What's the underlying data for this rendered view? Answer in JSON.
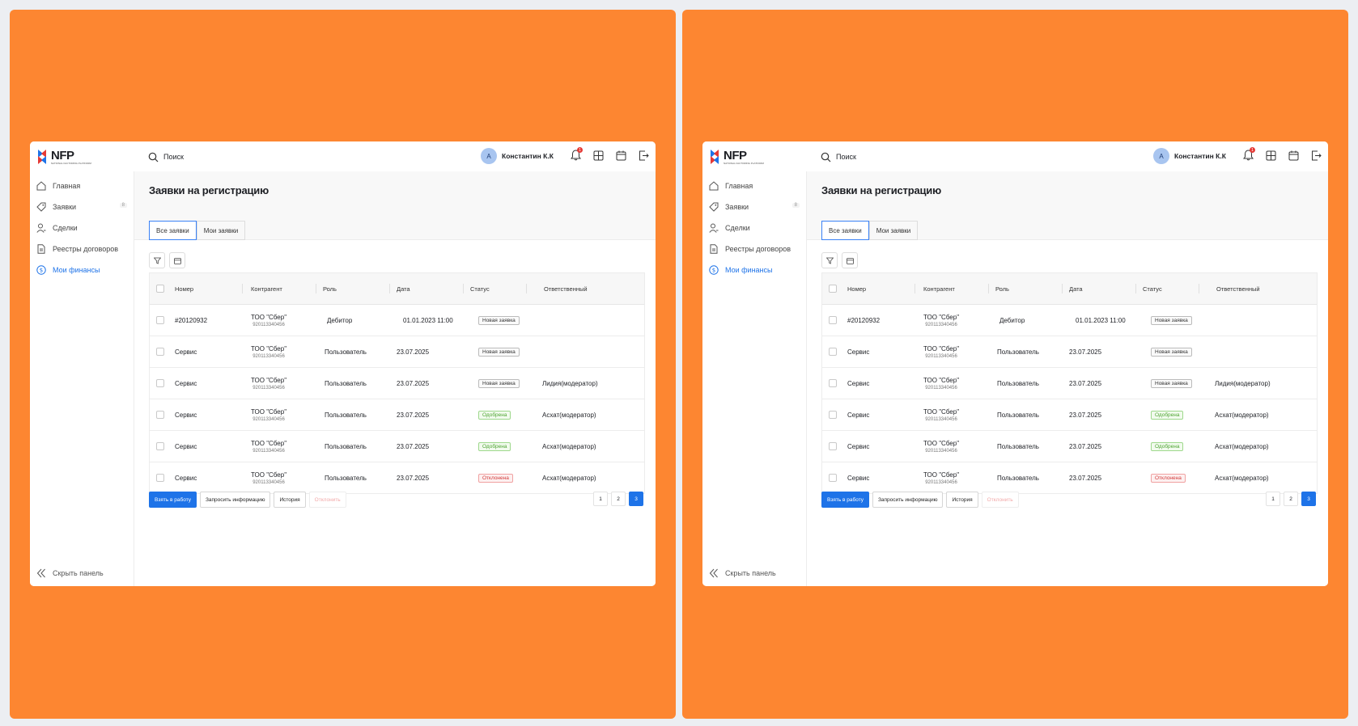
{
  "logo": {
    "text": "NFP",
    "subtitle": "NATIONAL FACTORING PLATFORM"
  },
  "search": {
    "label": "Поиск"
  },
  "user": {
    "initial": "А",
    "name": "Константин К.К"
  },
  "notifications": {
    "count": "1"
  },
  "sidebar": {
    "items": [
      {
        "label": "Главная",
        "icon": "home-icon"
      },
      {
        "label": "Заявки",
        "icon": "tag-icon",
        "count": "8"
      },
      {
        "label": "Сделки",
        "icon": "user-icon"
      },
      {
        "label": "Реестры договоров",
        "icon": "document-icon"
      },
      {
        "label": "Мои финансы",
        "icon": "dollar-icon"
      }
    ],
    "collapse_label": "Скрыть панель"
  },
  "page": {
    "title": "Заявки на регистрацию"
  },
  "tabs": [
    {
      "label": "Все заявки"
    },
    {
      "label": "Мои заявки"
    }
  ],
  "table": {
    "columns": [
      "Номер",
      "Контрагент",
      "Роль",
      "Дата",
      "Статус",
      "Ответственный"
    ],
    "rows": [
      {
        "number": "#20120932",
        "company": "ТОО \"Сбер\"",
        "bin": "920113340456",
        "role": "Дебитор",
        "date": "01.01.2023 11:00",
        "status": "Новая заявка",
        "status_type": "new",
        "responsible": ""
      },
      {
        "number": "Сервис",
        "company": "ТОО \"Сбер\"",
        "bin": "920113340456",
        "role": "Пользователь",
        "date": "23.07.2025",
        "status": "Новая заявка",
        "status_type": "new",
        "responsible": ""
      },
      {
        "number": "Сервис",
        "company": "ТОО \"Сбер\"",
        "bin": "920113340456",
        "role": "Пользователь",
        "date": "23.07.2025",
        "status": "Новая заявка",
        "status_type": "new",
        "responsible": "Лидия(модератор)"
      },
      {
        "number": "Сервис",
        "company": "ТОО \"Сбер\"",
        "bin": "920113340456",
        "role": "Пользователь",
        "date": "23.07.2025",
        "status": "Одобрена",
        "status_type": "ok",
        "responsible": "Асхат(модератор)"
      },
      {
        "number": "Сервис",
        "company": "ТОО \"Сбер\"",
        "bin": "920113340456",
        "role": "Пользователь",
        "date": "23.07.2025",
        "status": "Одобрена",
        "status_type": "ok",
        "responsible": "Асхат(модератор)"
      },
      {
        "number": "Сервис",
        "company": "ТОО \"Сбер\"",
        "bin": "920113340456",
        "role": "Пользователь",
        "date": "23.07.2025",
        "status": "Отклонена",
        "status_type": "rej",
        "responsible": "Асхат(модератор)"
      }
    ]
  },
  "actions": {
    "take": "Взять в работу",
    "request": "Запросить информацию",
    "history": "История",
    "reject": "Отклонить"
  },
  "pagination": {
    "pages": [
      "1",
      "2",
      "3"
    ],
    "active": "3"
  },
  "colors": {
    "background": "#fd8631",
    "accent": "#1e73e8",
    "approved": "#4fa534",
    "rejected": "#d23b3b"
  }
}
